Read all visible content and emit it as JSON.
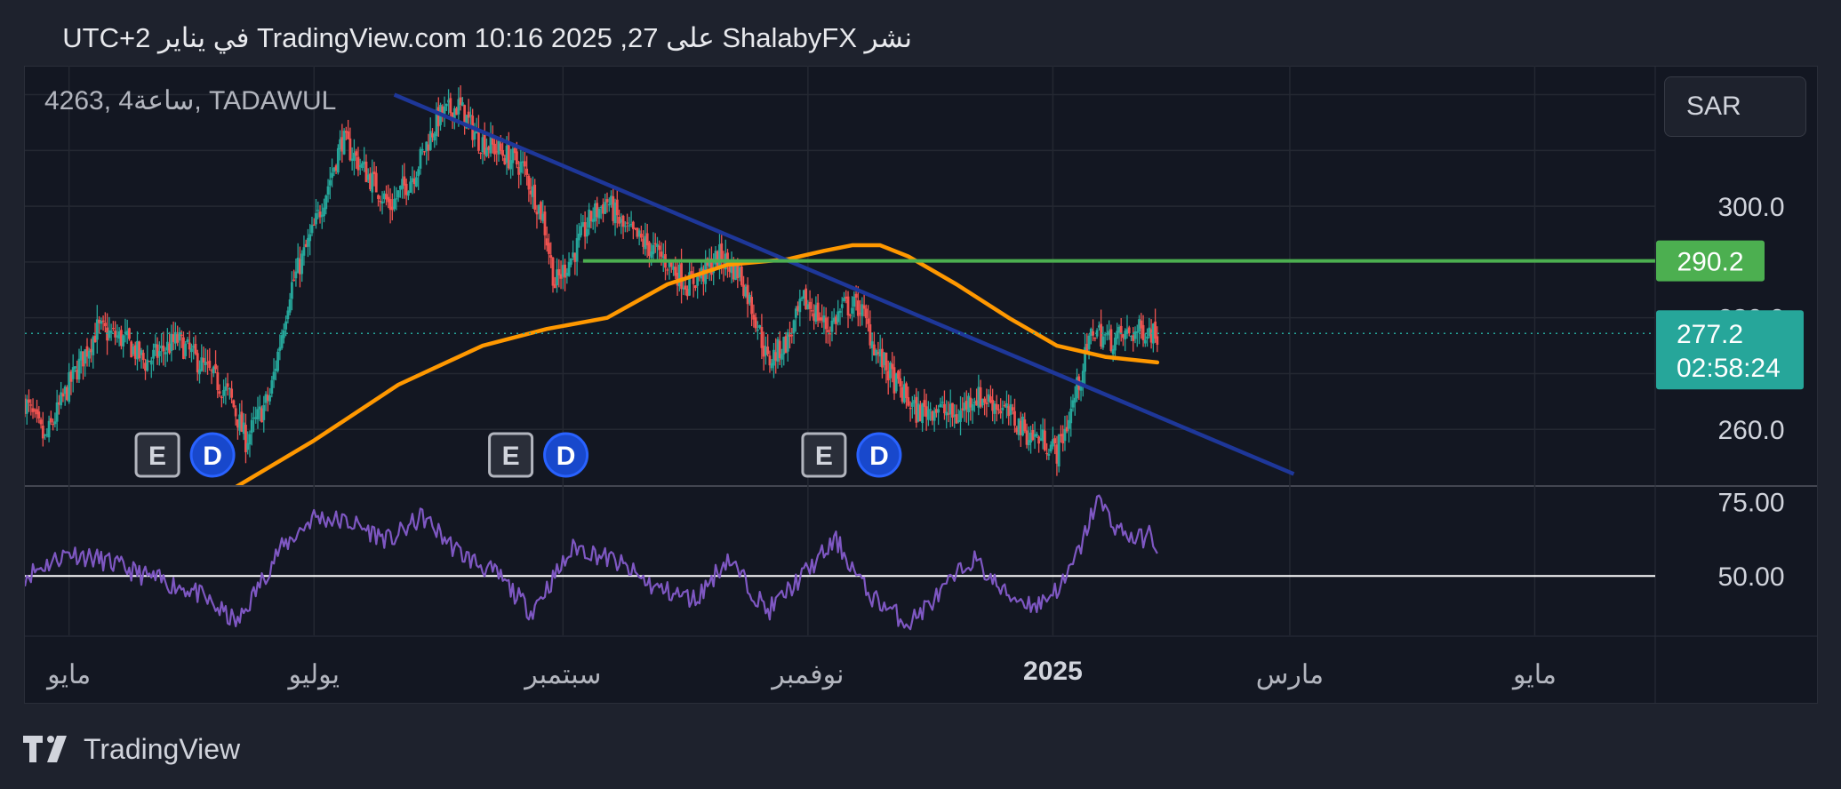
{
  "header": {
    "published": "نشر ShalabyFX على TradingView.com 10:16 2025 ,27 في يناير UTC+2"
  },
  "symbol": {
    "label": "4263, 4ساعة, TADAWUL"
  },
  "currency": {
    "label": "SAR"
  },
  "footer": {
    "brand": "TradingView"
  },
  "colors": {
    "background": "#131722",
    "page": "#1e222d",
    "candle_up": "#26a69a",
    "candle_down": "#ef5350",
    "ma": "#ff9800",
    "trendline": "#1e3799",
    "resistance": "#4caf50",
    "rsi": "#7e57c2",
    "price_label": "#26a69a"
  },
  "chart_data": [
    {
      "type": "candlestick",
      "panel": "price",
      "y_range": [
        250,
        322
      ],
      "y_ticks": [
        "300.0",
        "260.0"
      ],
      "x_range": [
        "2024-04-20",
        "2025-05-31"
      ],
      "x_ticks": [
        {
          "date": "2024-05-01",
          "label": "مايو",
          "bold": false
        },
        {
          "date": "2024-07-01",
          "label": "يوليو",
          "bold": false
        },
        {
          "date": "2024-09-01",
          "label": "سبتمبر",
          "bold": false
        },
        {
          "date": "2024-11-01",
          "label": "نوفمبر",
          "bold": false
        },
        {
          "date": "2025-01-01",
          "label": "2025",
          "bold": true
        },
        {
          "date": "2025-03-01",
          "label": "مارس",
          "bold": false
        },
        {
          "date": "2025-05-01",
          "label": "مايو",
          "bold": false
        }
      ],
      "close_path": [
        [
          "2024-04-20",
          265
        ],
        [
          "2024-04-25",
          258
        ],
        [
          "2024-05-01",
          268
        ],
        [
          "2024-05-08",
          278
        ],
        [
          "2024-05-15",
          276
        ],
        [
          "2024-05-20",
          272
        ],
        [
          "2024-05-28",
          276
        ],
        [
          "2024-06-05",
          270
        ],
        [
          "2024-06-10",
          266
        ],
        [
          "2024-06-14",
          258
        ],
        [
          "2024-06-20",
          266
        ],
        [
          "2024-06-25",
          285
        ],
        [
          "2024-07-01",
          296
        ],
        [
          "2024-07-05",
          305
        ],
        [
          "2024-07-08",
          312
        ],
        [
          "2024-07-14",
          306
        ],
        [
          "2024-07-20",
          300
        ],
        [
          "2024-07-26",
          306
        ],
        [
          "2024-08-01",
          316
        ],
        [
          "2024-08-06",
          318
        ],
        [
          "2024-08-11",
          312
        ],
        [
          "2024-08-16",
          310
        ],
        [
          "2024-08-22",
          307
        ],
        [
          "2024-08-27",
          298
        ],
        [
          "2024-08-30",
          286
        ],
        [
          "2024-09-04",
          292
        ],
        [
          "2024-09-08",
          298
        ],
        [
          "2024-09-12",
          301
        ],
        [
          "2024-09-16",
          296
        ],
        [
          "2024-09-22",
          293
        ],
        [
          "2024-09-27",
          290
        ],
        [
          "2024-10-02",
          286
        ],
        [
          "2024-10-06",
          288
        ],
        [
          "2024-10-10",
          291
        ],
        [
          "2024-10-15",
          288
        ],
        [
          "2024-10-19",
          280
        ],
        [
          "2024-10-22",
          272
        ],
        [
          "2024-10-27",
          276
        ],
        [
          "2024-10-31",
          283
        ],
        [
          "2024-11-03",
          281
        ],
        [
          "2024-11-06",
          278
        ],
        [
          "2024-11-10",
          282
        ],
        [
          "2024-11-14",
          282
        ],
        [
          "2024-11-18",
          274
        ],
        [
          "2024-11-23",
          268
        ],
        [
          "2024-11-28",
          263
        ],
        [
          "2024-12-03",
          264
        ],
        [
          "2024-12-08",
          262
        ],
        [
          "2024-12-12",
          266
        ],
        [
          "2024-12-17",
          265
        ],
        [
          "2024-12-22",
          262
        ],
        [
          "2024-12-26",
          259
        ],
        [
          "2024-12-30",
          258
        ],
        [
          "2025-01-02",
          256
        ],
        [
          "2025-01-05",
          262
        ],
        [
          "2025-01-08",
          270
        ],
        [
          "2025-01-11",
          278
        ],
        [
          "2025-01-15",
          276
        ],
        [
          "2025-01-20",
          277
        ],
        [
          "2025-01-24",
          278
        ],
        [
          "2025-01-27",
          277.2
        ]
      ],
      "last_price": "277.2",
      "countdown": "02:58:24",
      "resistance": {
        "value": 290.2,
        "label": "290.2",
        "start": "2024-09-06"
      },
      "trendline": {
        "start": [
          "2024-07-21",
          320
        ],
        "end": [
          "2025-03-02",
          252
        ]
      },
      "moving_average": [
        [
          "2024-06-10",
          249
        ],
        [
          "2024-07-01",
          258
        ],
        [
          "2024-07-22",
          268
        ],
        [
          "2024-08-12",
          275
        ],
        [
          "2024-08-28",
          278
        ],
        [
          "2024-09-12",
          280
        ],
        [
          "2024-09-27",
          286
        ],
        [
          "2024-10-12",
          289.5
        ],
        [
          "2024-10-27",
          290.5
        ],
        [
          "2024-11-05",
          292
        ],
        [
          "2024-11-12",
          293
        ],
        [
          "2024-11-19",
          293
        ],
        [
          "2024-11-26",
          291
        ],
        [
          "2024-12-08",
          286
        ],
        [
          "2024-12-21",
          280
        ],
        [
          "2025-01-02",
          275
        ],
        [
          "2025-01-14",
          273
        ],
        [
          "2025-01-27",
          272
        ]
      ],
      "events": [
        {
          "date": "2024-05-23",
          "earnings": "E",
          "dividend": "D"
        },
        {
          "date": "2024-08-19",
          "earnings": "E",
          "dividend": "D"
        },
        {
          "date": "2024-11-05",
          "earnings": "E",
          "dividend": "D"
        }
      ]
    },
    {
      "type": "line",
      "panel": "rsi",
      "y_range": [
        30,
        80
      ],
      "y_ticks": [
        "75.00",
        "50.00"
      ],
      "reference_line": 50,
      "series_path": [
        [
          "2024-04-20",
          50
        ],
        [
          "2024-05-01",
          58
        ],
        [
          "2024-05-10",
          55
        ],
        [
          "2024-05-20",
          50
        ],
        [
          "2024-06-01",
          45
        ],
        [
          "2024-06-12",
          34
        ],
        [
          "2024-06-22",
          58
        ],
        [
          "2024-07-01",
          70
        ],
        [
          "2024-07-10",
          68
        ],
        [
          "2024-07-20",
          62
        ],
        [
          "2024-07-28",
          70
        ],
        [
          "2024-08-06",
          58
        ],
        [
          "2024-08-16",
          50
        ],
        [
          "2024-08-24",
          38
        ],
        [
          "2024-09-04",
          60
        ],
        [
          "2024-09-14",
          55
        ],
        [
          "2024-09-24",
          46
        ],
        [
          "2024-10-04",
          42
        ],
        [
          "2024-10-12",
          56
        ],
        [
          "2024-10-22",
          38
        ],
        [
          "2024-11-01",
          52
        ],
        [
          "2024-11-08",
          62
        ],
        [
          "2024-11-16",
          44
        ],
        [
          "2024-11-26",
          34
        ],
        [
          "2024-12-04",
          44
        ],
        [
          "2024-12-12",
          56
        ],
        [
          "2024-12-20",
          44
        ],
        [
          "2024-12-28",
          40
        ],
        [
          "2025-01-04",
          48
        ],
        [
          "2025-01-08",
          60
        ],
        [
          "2025-01-12",
          76
        ],
        [
          "2025-01-17",
          66
        ],
        [
          "2025-01-22",
          62
        ],
        [
          "2025-01-25",
          64
        ],
        [
          "2025-01-27",
          60
        ]
      ]
    }
  ]
}
